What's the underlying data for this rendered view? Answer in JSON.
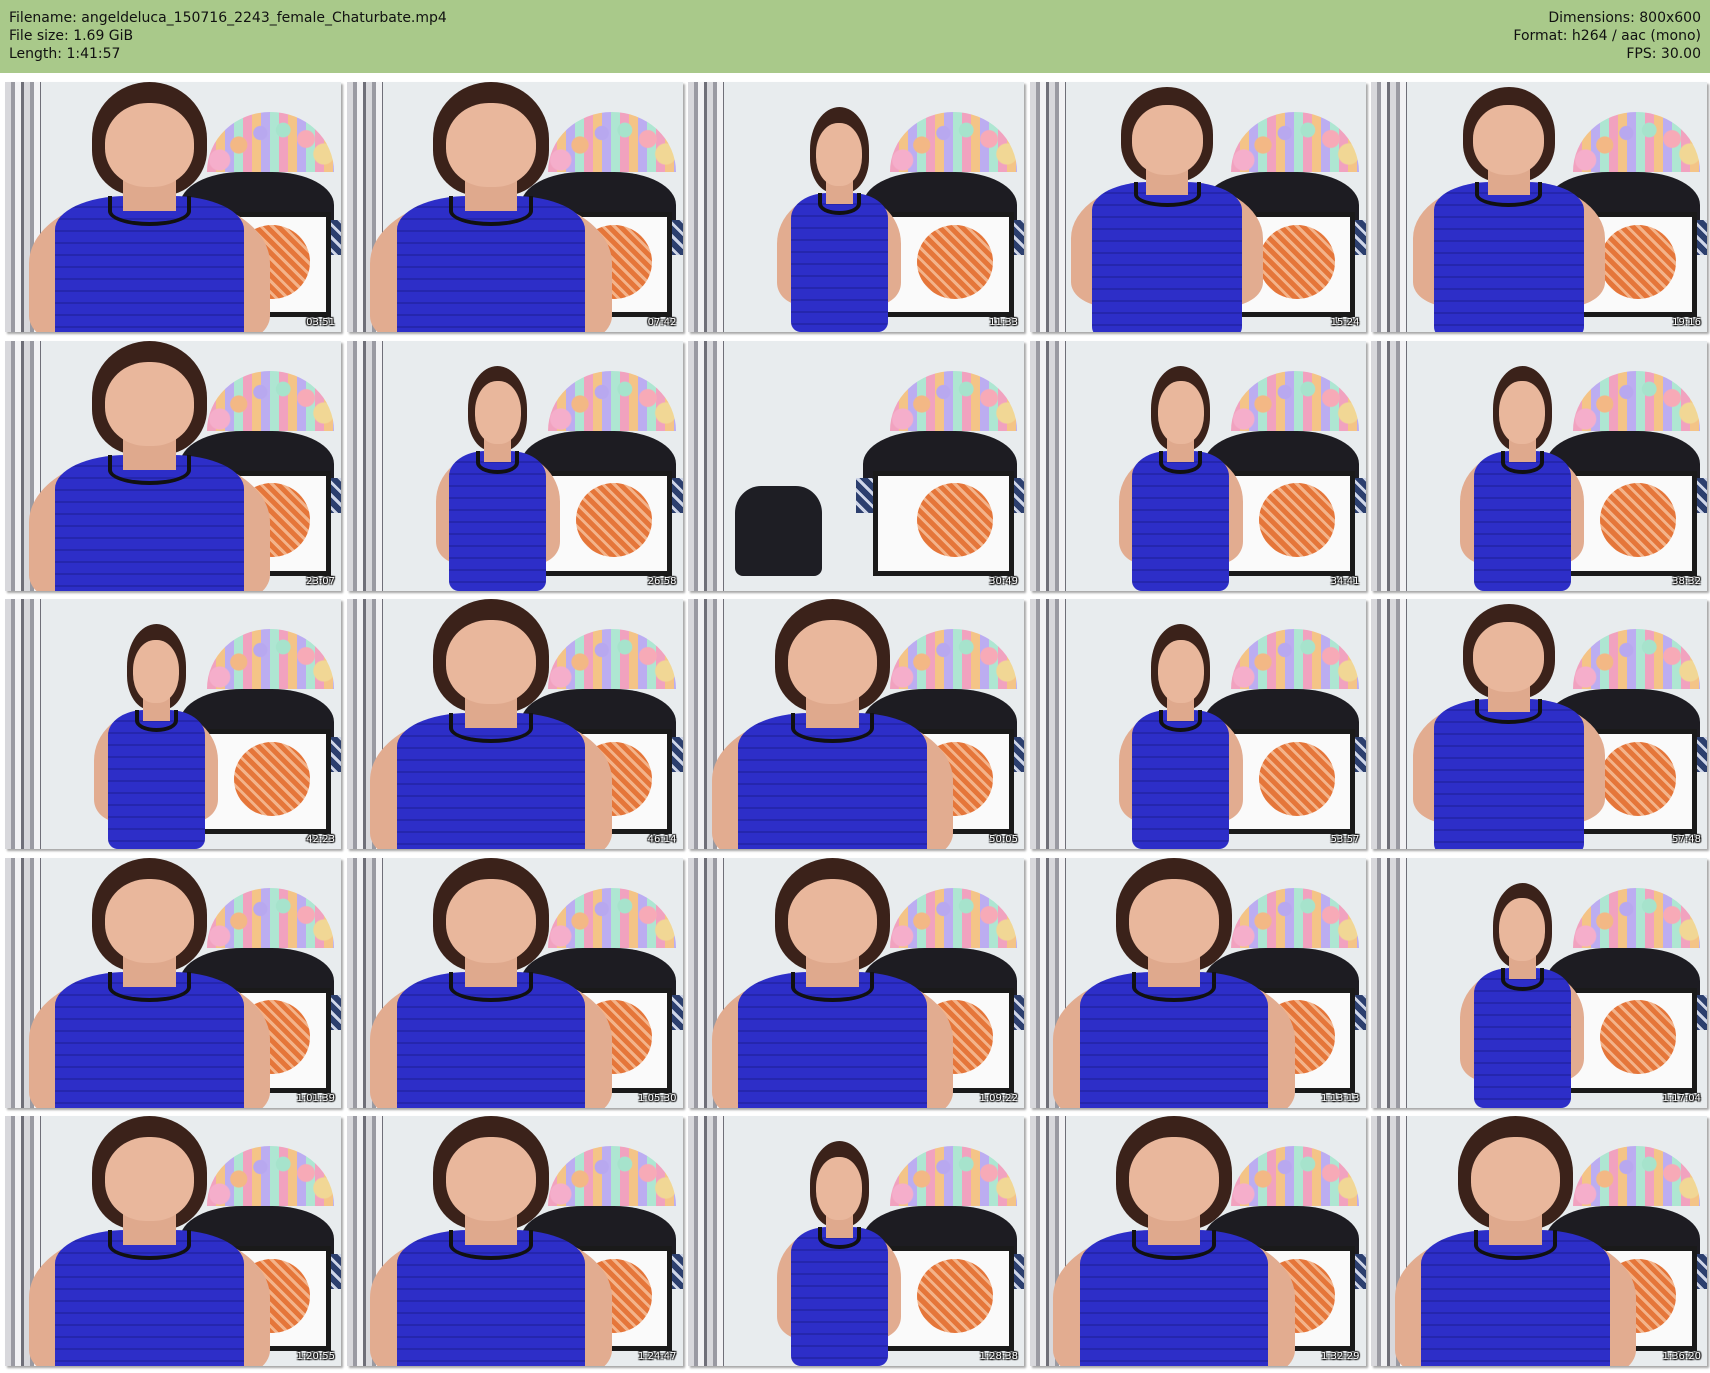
{
  "header": {
    "filename": "Filename: angeldeluca_150716_2243_female_Chaturbate.mp4",
    "filesize": "File size: 1.69 GiB",
    "length": "Length: 1:41:57",
    "dimensions": "Dimensions: 800x600",
    "format": "Format: h264 / aac (mono)",
    "fps": "FPS: 30.00"
  },
  "thumbnails": [
    {
      "timestamp": "03:51",
      "view": "close"
    },
    {
      "timestamp": "07:42",
      "view": "close"
    },
    {
      "timestamp": "11:33",
      "view": "far"
    },
    {
      "timestamp": "15:24",
      "view": "seat"
    },
    {
      "timestamp": "19:16",
      "view": "seat"
    },
    {
      "timestamp": "23:07",
      "view": "close"
    },
    {
      "timestamp": "26:58",
      "view": "far"
    },
    {
      "timestamp": "30:49",
      "view": "empty"
    },
    {
      "timestamp": "34:41",
      "view": "far"
    },
    {
      "timestamp": "38:32",
      "view": "far"
    },
    {
      "timestamp": "42:23",
      "view": "far"
    },
    {
      "timestamp": "46:14",
      "view": "close"
    },
    {
      "timestamp": "50:05",
      "view": "close"
    },
    {
      "timestamp": "53:57",
      "view": "far"
    },
    {
      "timestamp": "57:48",
      "view": "seat"
    },
    {
      "timestamp": "1:01:39",
      "view": "close"
    },
    {
      "timestamp": "1:05:30",
      "view": "close"
    },
    {
      "timestamp": "1:09:22",
      "view": "close"
    },
    {
      "timestamp": "1:13:13",
      "view": "close"
    },
    {
      "timestamp": "1:17:04",
      "view": "far"
    },
    {
      "timestamp": "1:20:55",
      "view": "close"
    },
    {
      "timestamp": "1:24:47",
      "view": "close"
    },
    {
      "timestamp": "1:28:38",
      "view": "far"
    },
    {
      "timestamp": "1:32:29",
      "view": "close"
    },
    {
      "timestamp": "1:36:20",
      "view": "close"
    }
  ],
  "colors": {
    "header_bg": "#a9c98a",
    "dress": "#2d2ec8",
    "timestamp_text": "#ffffff"
  }
}
